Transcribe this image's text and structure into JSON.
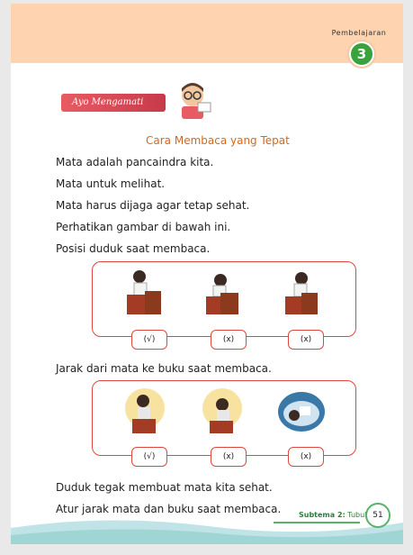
{
  "badge": {
    "label": "Pembelajaran",
    "number": "3"
  },
  "activity": {
    "banner": "Ayo Mengamati"
  },
  "section": {
    "title": "Cara Membaca yang Tepat"
  },
  "paragraphs": [
    "Mata adalah pancaindra kita.",
    "Mata untuk melihat.",
    "Mata harus dijaga agar tetap sehat.",
    "Perhatikan gambar di bawah ini.",
    "Posisi duduk saat membaca."
  ],
  "panel1": {
    "labels": [
      "(√)",
      "(x)",
      "(x)"
    ]
  },
  "caption2": "Jarak dari mata ke buku saat membaca.",
  "panel2": {
    "labels": [
      "(√)",
      "(x)",
      "(x)"
    ]
  },
  "closing": [
    "Duduk tegak membuat mata kita sehat.",
    "Atur jarak mata dan buku saat membaca."
  ],
  "footer": {
    "subtheme_label": "Subtema 2:",
    "subtheme_name": "Tubuhku",
    "page": "51"
  },
  "colors": {
    "band": "#fdd3b0",
    "accent_red": "#e0473f",
    "green": "#3aa23c",
    "title_orange": "#d2691e"
  }
}
